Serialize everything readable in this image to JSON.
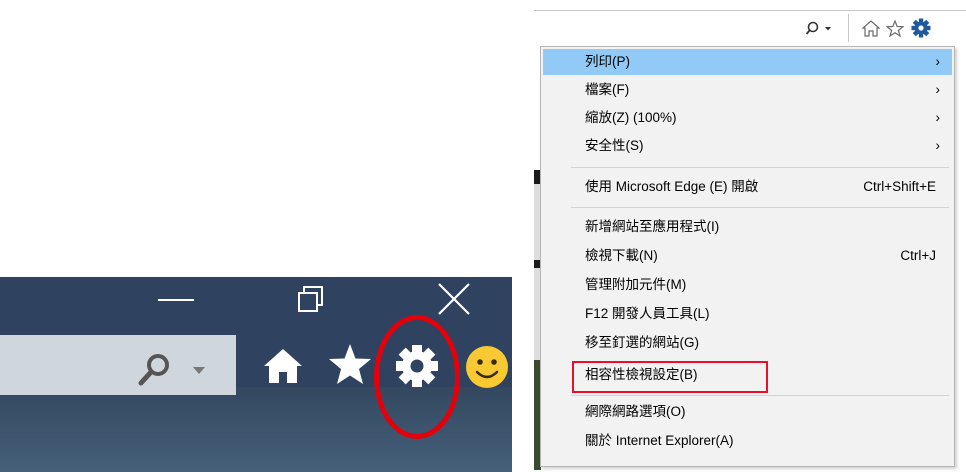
{
  "menu": {
    "items": [
      {
        "label": "列印(P)",
        "shortcut": "",
        "arrow": "›"
      },
      {
        "label": "檔案(F)",
        "shortcut": "",
        "arrow": "›"
      },
      {
        "label": "縮放(Z) (100%)",
        "shortcut": "",
        "arrow": "›"
      },
      {
        "label": "安全性(S)",
        "shortcut": "",
        "arrow": "›"
      },
      {
        "label": "使用 Microsoft Edge (E) 開啟",
        "shortcut": "Ctrl+Shift+E",
        "arrow": ""
      },
      {
        "label": "新增網站至應用程式(I)",
        "shortcut": "",
        "arrow": ""
      },
      {
        "label": "檢視下載(N)",
        "shortcut": "Ctrl+J",
        "arrow": ""
      },
      {
        "label": "管理附加元件(M)",
        "shortcut": "",
        "arrow": ""
      },
      {
        "label": "F12 開發人員工具(L)",
        "shortcut": "",
        "arrow": ""
      },
      {
        "label": "移至釘選的網站(G)",
        "shortcut": "",
        "arrow": ""
      },
      {
        "label": "相容性檢視設定(B)",
        "shortcut": "",
        "arrow": ""
      },
      {
        "label": "網際網路選項(O)",
        "shortcut": "",
        "arrow": ""
      },
      {
        "label": "關於 Internet Explorer(A)",
        "shortcut": "",
        "arrow": ""
      }
    ],
    "highlighted_index": 0,
    "annotated_index": 10
  },
  "icons": {
    "search": "search-icon",
    "home": "home-icon",
    "favorites": "star-icon",
    "tools": "gear-icon",
    "feedback": "smiley-icon"
  },
  "colors": {
    "highlight": "#91c9f7",
    "annotation_red": "#e8102a",
    "toolbar_dark": "#2f4260"
  }
}
